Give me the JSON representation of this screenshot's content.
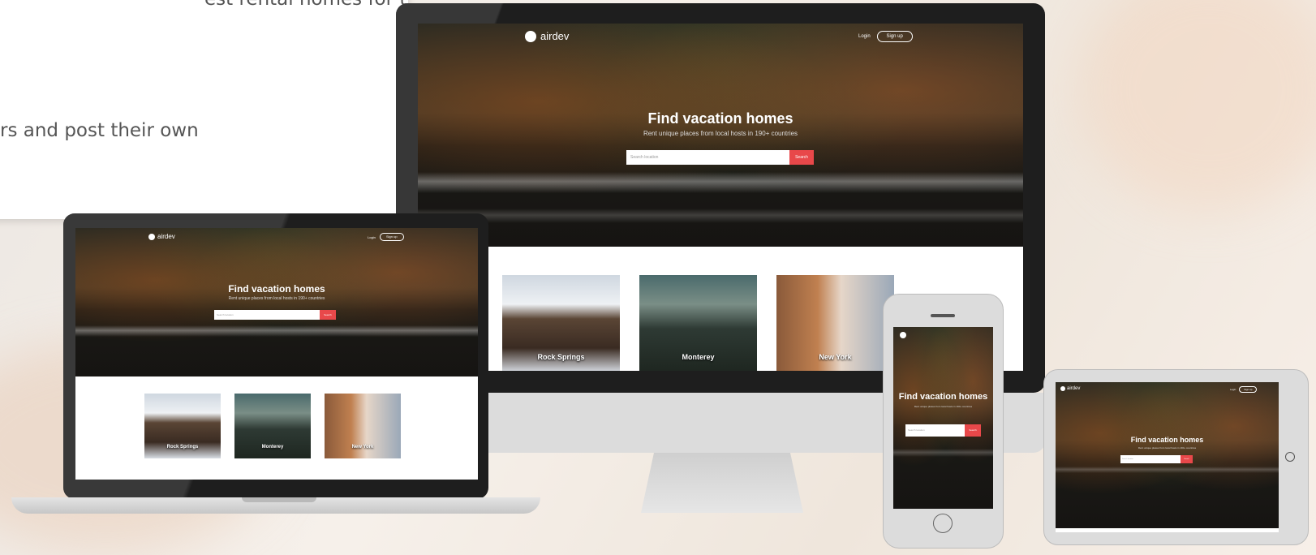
{
  "intro_text": {
    "line1": "est rental homes for their",
    "line2": "rs and post their own"
  },
  "site": {
    "logo_text": "airdev",
    "nav_login": "Login",
    "nav_signup": "Sign up",
    "hero_title": "Find vacation homes",
    "hero_subtitle": "Rent unique places from local hosts in 190+ countries",
    "search_placeholder": "Search location",
    "search_button": "Search",
    "cards": [
      "Rock Springs",
      "Monterey",
      "New York"
    ]
  },
  "colors": {
    "accent": "#e8484a",
    "bezel": "#1e1e1e",
    "device_silver": "#dcdcdc"
  }
}
